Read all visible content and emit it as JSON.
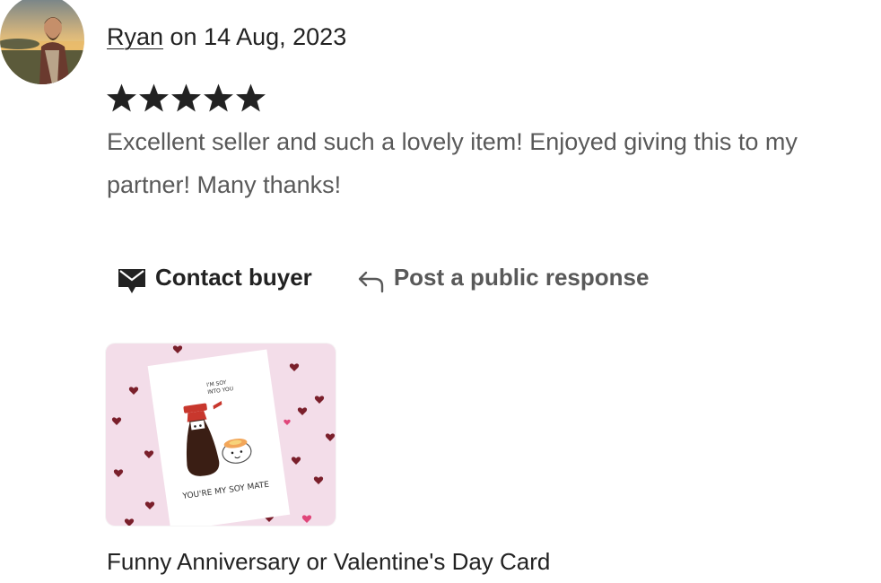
{
  "review": {
    "reviewer_name": "Ryan",
    "date_text": " on 14 Aug, 2023",
    "rating": 5,
    "rating_max": 5,
    "text": "Excellent seller and such a lovely item! Enjoyed giving this to my partner! Many thanks!"
  },
  "actions": {
    "contact_label": "Contact buyer",
    "respond_label": "Post a public response"
  },
  "product": {
    "title": "Funny Anniversary or Valentine's Day Card",
    "card_text_top_line1": "I'M SOY",
    "card_text_top_line2": "INTO YOU",
    "card_text_bottom": "YOU'RE MY SOY MATE"
  },
  "colors": {
    "text_primary": "#222222",
    "text_secondary": "#595959",
    "star": "#222222",
    "card_background": "#f3dde9",
    "heart": "#7a1f2b"
  },
  "icons": {
    "contact": "envelope-icon",
    "respond": "reply-arrow-icon"
  }
}
